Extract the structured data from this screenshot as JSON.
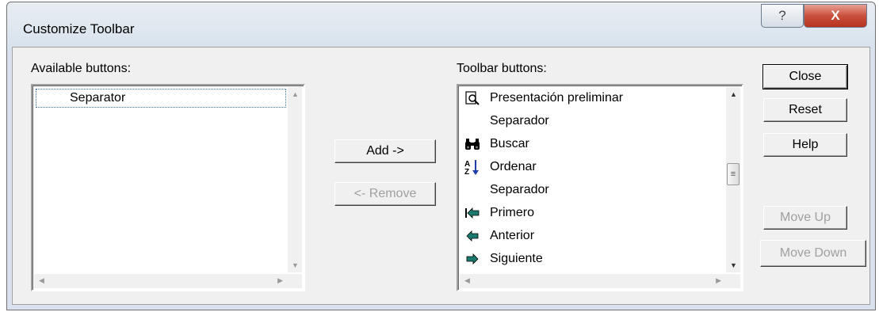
{
  "window": {
    "title": "Customize Toolbar",
    "help_label": "?",
    "close_label": "X"
  },
  "available": {
    "label": "Available buttons:",
    "items": [
      {
        "label": "Separator",
        "icon": ""
      }
    ]
  },
  "toolbar": {
    "label": "Toolbar buttons:",
    "items": [
      {
        "label": "Presentación preliminar",
        "icon": "print-preview-icon"
      },
      {
        "label": "Separador",
        "icon": ""
      },
      {
        "label": "Buscar",
        "icon": "binoculars-icon"
      },
      {
        "label": "Ordenar",
        "icon": "sort-az-icon"
      },
      {
        "label": "Separador",
        "icon": ""
      },
      {
        "label": "Primero",
        "icon": "first-record-icon"
      },
      {
        "label": "Anterior",
        "icon": "previous-record-icon"
      },
      {
        "label": "Siguiente",
        "icon": "next-record-icon"
      }
    ]
  },
  "buttons": {
    "add": "Add ->",
    "remove": "<- Remove",
    "close": "Close",
    "reset": "Reset",
    "help": "Help",
    "move_up": "Move Up",
    "move_down": "Move Down"
  },
  "colors": {
    "accent_icon": "#1a7a6e",
    "sort_blue": "#1e3fa8"
  }
}
